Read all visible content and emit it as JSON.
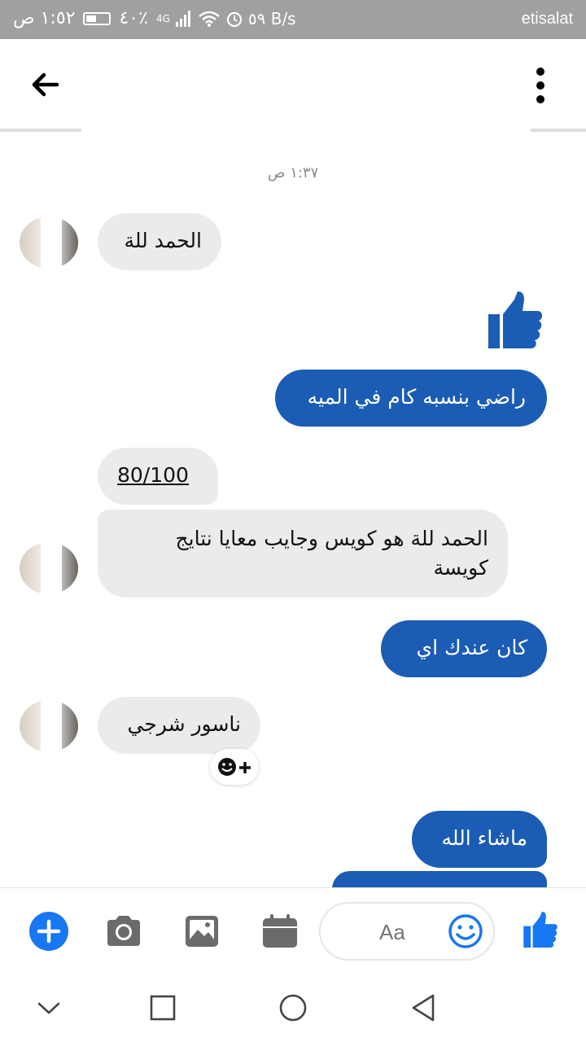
{
  "status_bar": {
    "time": "١:٥٢ ص",
    "battery": "٤٠٪",
    "network": "4G",
    "speed": "٥٩ B/s",
    "carrier": "etisalat"
  },
  "chat": {
    "timestamp": "١:٣٧ ص",
    "messages": [
      {
        "dir": "in",
        "text": "الحمد للة"
      },
      {
        "dir": "out",
        "text": "راضي بنسبه كام في الميه"
      },
      {
        "dir": "in",
        "text": "80/100"
      },
      {
        "dir": "in",
        "text": "الحمد للة هو كويس وجايب معايا نتايج كويسة"
      },
      {
        "dir": "out",
        "text": "كان عندك اي"
      },
      {
        "dir": "in",
        "text": "ناسور شرجي"
      },
      {
        "dir": "out",
        "text": "ماشاء الله"
      }
    ]
  },
  "composer": {
    "placeholder": "Aa"
  },
  "colors": {
    "outgoing": "#1b5cb5",
    "incoming": "#ebebeb",
    "accent": "#1877f2"
  },
  "icons": [
    "back-arrow-icon",
    "more-vert-icon",
    "thumbs-up-icon",
    "add-reaction-icon",
    "plus-icon",
    "camera-icon",
    "image-icon",
    "calendar-icon",
    "emoji-icon",
    "nav-down-icon",
    "nav-square-icon",
    "nav-circle-icon",
    "nav-back-icon"
  ]
}
